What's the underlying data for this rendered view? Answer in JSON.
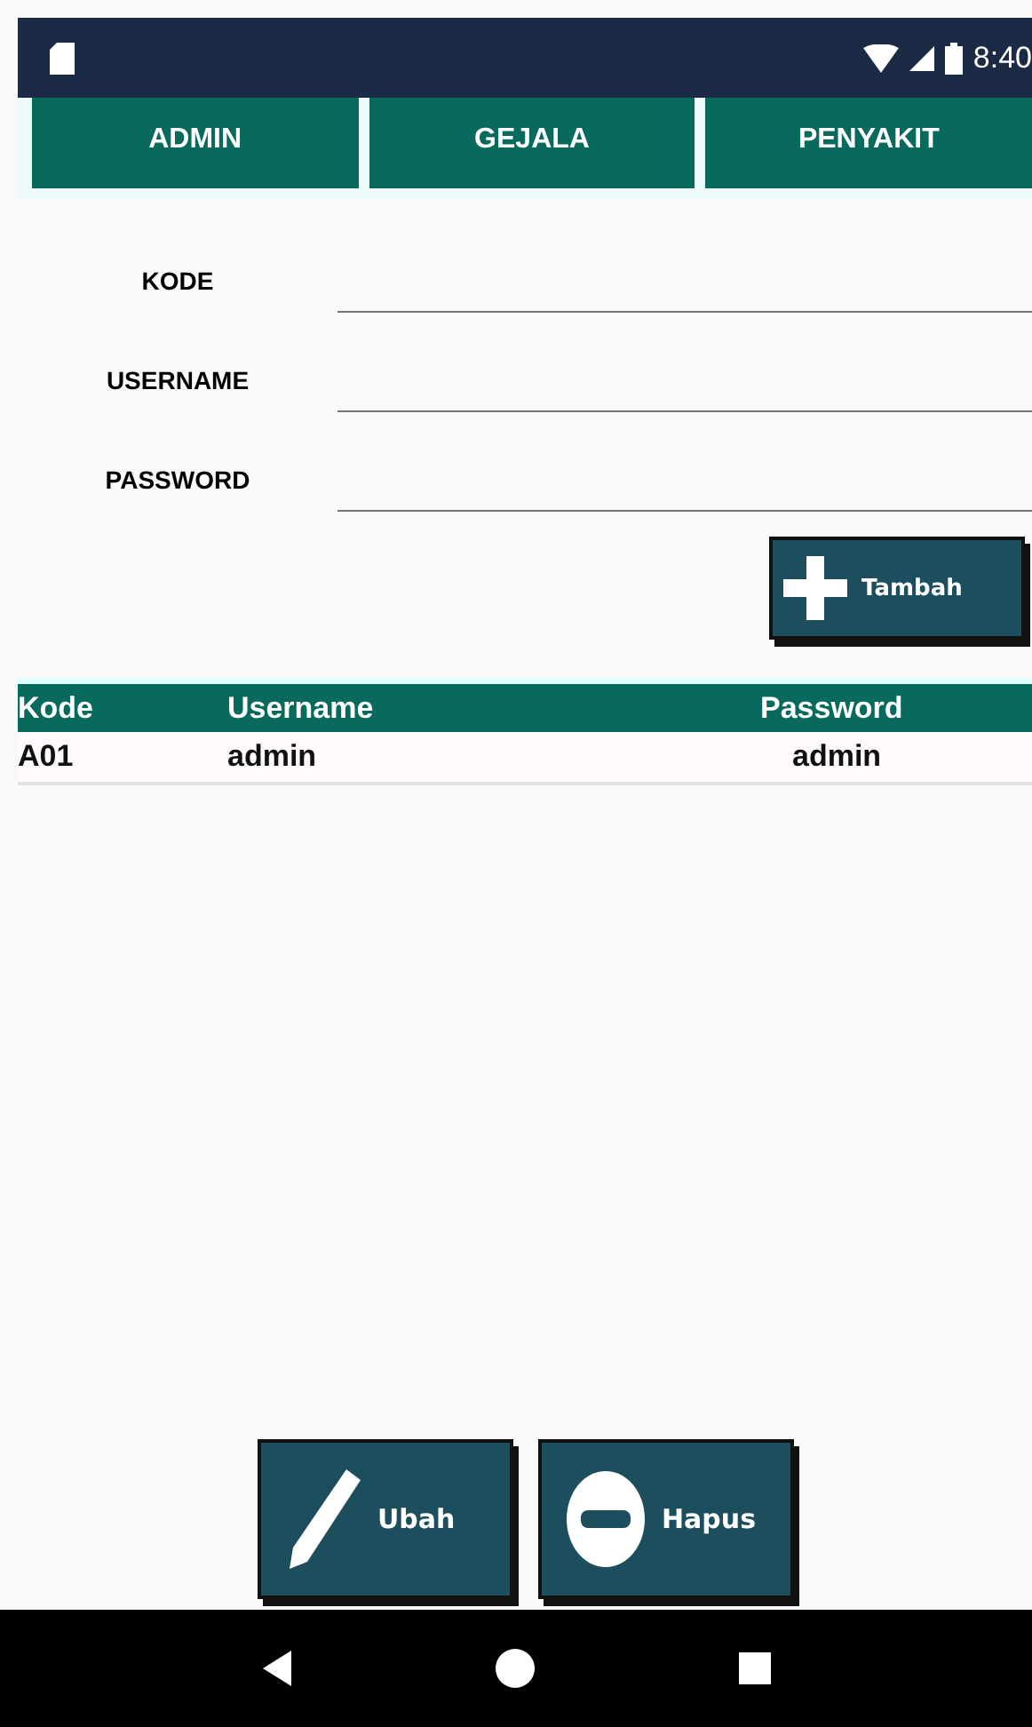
{
  "status_bar": {
    "time": "8:40"
  },
  "tabs": [
    {
      "label": "ADMIN",
      "selected": false
    },
    {
      "label": "GEJALA",
      "selected": false
    },
    {
      "label": "PENYAKIT",
      "selected": false
    }
  ],
  "form": {
    "fields": [
      {
        "label": "KODE"
      },
      {
        "label": "USERNAME"
      },
      {
        "label": "PASSWORD"
      }
    ],
    "add_button": "Tambah"
  },
  "table": {
    "columns": [
      "Kode",
      "Username",
      "Password"
    ],
    "rows": [
      [
        "A01",
        "admin",
        "admin"
      ]
    ]
  },
  "buttons": [
    {
      "kind": "edit",
      "label": "Ubah"
    },
    {
      "kind": "delete",
      "label": "Hapus"
    }
  ]
}
